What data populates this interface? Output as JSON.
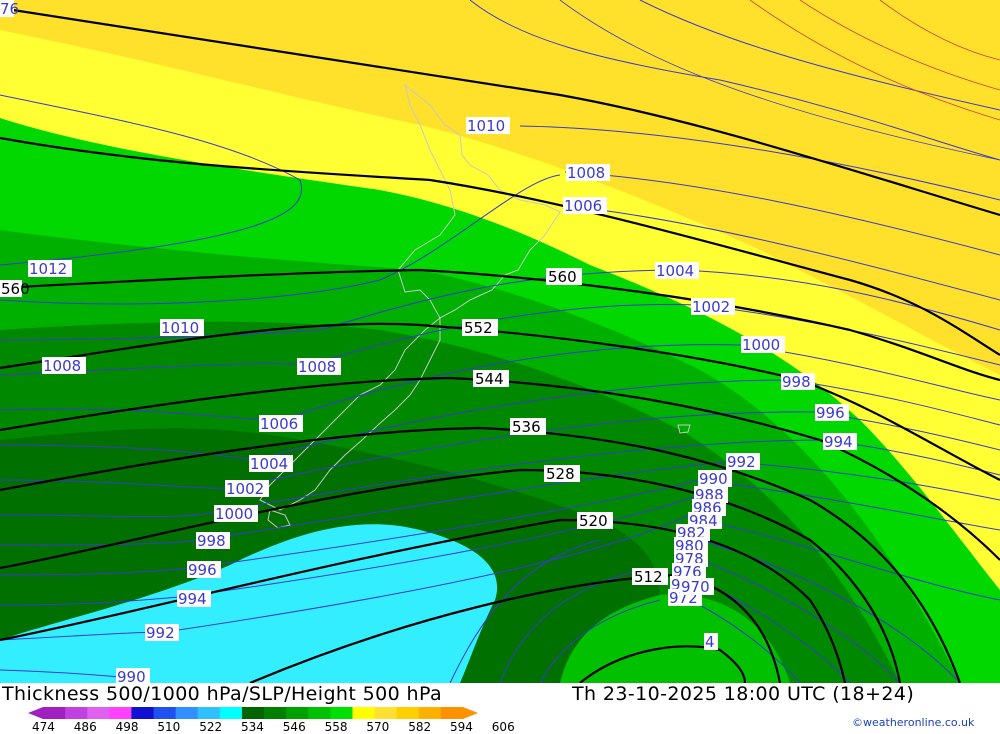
{
  "title": "Thickness 500/1000 hPa/SLP/Height 500 hPa",
  "valid_time": "Th 23-10-2025 18:00 UTC (18+24)",
  "credit": "©weatheronline.co.uk",
  "legend": {
    "labels": [
      "474",
      "486",
      "498",
      "510",
      "522",
      "534",
      "546",
      "558",
      "570",
      "582",
      "594",
      "606"
    ],
    "colors": [
      "#a020c0",
      "#c040e0",
      "#e060f0",
      "#ff40ff",
      "#1010d0",
      "#2050f0",
      "#3090ff",
      "#30c0ff",
      "#00ffff",
      "#006400",
      "#008000",
      "#00a000",
      "#00c000",
      "#00e000",
      "#ffff00",
      "#ffe030",
      "#ffd000",
      "#ffb000",
      "#ff9000"
    ]
  },
  "map": {
    "corner_label_top": "76",
    "slp_labels": [
      "1010",
      "1008",
      "1006",
      "1004",
      "1002",
      "1000",
      "998",
      "996",
      "994",
      "992",
      "990",
      "988",
      "986",
      "984",
      "982",
      "980",
      "978",
      "976",
      "974",
      "972",
      "970",
      "1012",
      "1010",
      "1008",
      "1008",
      "1006",
      "1004",
      "1002",
      "1000",
      "998",
      "996",
      "994",
      "992",
      "990",
      "4"
    ],
    "height_labels": [
      "560",
      "560",
      "552",
      "544",
      "536",
      "528",
      "520",
      "512"
    ],
    "colors": {
      "thickness_yellow": "#ffff33",
      "thickness_gold": "#ffe02a",
      "thickness_green_light": "#00d800",
      "thickness_green_mid": "#00b000",
      "thickness_green_dark": "#008800",
      "thickness_green_darkest": "#007000",
      "thickness_cyan": "#33eeff",
      "slp_isobar": "#3a3acd",
      "height_contour": "#000000"
    }
  }
}
